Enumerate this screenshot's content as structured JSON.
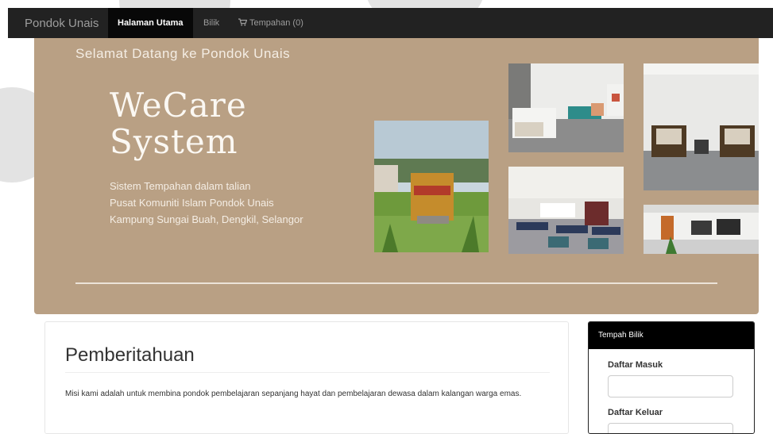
{
  "navbar": {
    "brand": "Pondok Unais",
    "items": [
      {
        "label": "Halaman Utama",
        "active": true
      },
      {
        "label": "Bilik",
        "active": false
      },
      {
        "label": "Tempahan (0)",
        "active": false,
        "icon": "cart-icon"
      }
    ]
  },
  "hero": {
    "welcome": "Selamat Datang ke Pondok Unais",
    "title_line1": "WeCare",
    "title_line2": "System",
    "desc_line1": "Sistem Tempahan dalam talian",
    "desc_line2": "Pusat Komuniti Islam Pondok Unais",
    "desc_line3": "Kampung Sungai Buah, Dengkil, Selangor",
    "background_color": "#b9a084"
  },
  "notice": {
    "title": "Pemberitahuan",
    "text": "Misi kami adalah untuk membina pondok pembelajaran sepanjang hayat dan pembelajaran dewasa dalam kalangan warga emas."
  },
  "booking": {
    "header": "Tempah Bilik",
    "checkin_label": "Daftar Masuk",
    "checkin_value": "",
    "checkout_label": "Daftar Keluar",
    "checkout_value": ""
  }
}
